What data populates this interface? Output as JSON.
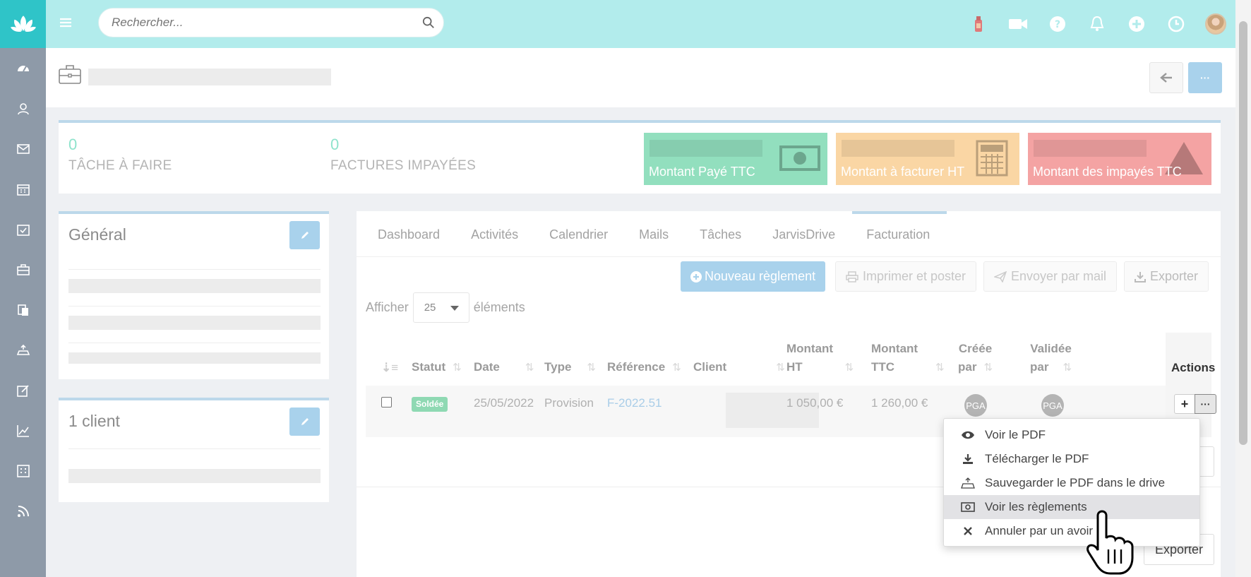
{
  "topbar": {
    "search_placeholder": "Rechercher..."
  },
  "sidebar": {
    "icons": [
      "dashboard-icon",
      "contacts-icon",
      "mail-icon",
      "calendar-icon",
      "tasks-icon",
      "briefcase-icon",
      "documents-icon",
      "drive-icon",
      "edit-icon",
      "chart-icon",
      "grid-icon",
      "rss-icon"
    ]
  },
  "stats": {
    "tasks_count": "0",
    "tasks_label": "TÂCHE À FAIRE",
    "invoices_count": "0",
    "invoices_label": "FACTURES IMPAYÉES",
    "tile_paid": "Montant Payé TTC",
    "tile_to_invoice": "Montant à facturer HT",
    "tile_unpaid": "Montant des impayés TTC",
    "colors": {
      "paid": "#92dfbe",
      "to_invoice": "#fad6a4",
      "unpaid": "#f4a3a3"
    }
  },
  "general_panel": {
    "title": "Général"
  },
  "client_panel": {
    "title": "1 client"
  },
  "tabs": [
    "Dashboard",
    "Activités",
    "Calendrier",
    "Mails",
    "Tâches",
    "JarvisDrive",
    "Facturation"
  ],
  "toolbar": {
    "new_payment": "Nouveau règlement",
    "print": "Imprimer et poster",
    "send_mail": "Envoyer par mail",
    "export": "Exporter"
  },
  "pagination": {
    "show": "Afficher",
    "page_size": "25",
    "items": "éléments"
  },
  "table": {
    "columns": {
      "statut": "Statut",
      "date": "Date",
      "type": "Type",
      "reference": "Référence",
      "client": "Client",
      "montant_ht_1": "Montant",
      "montant_ht_2": "HT",
      "montant_ttc_1": "Montant",
      "montant_ttc_2": "TTC",
      "creee_1": "Créée",
      "creee_2": "par",
      "validee_1": "Validée",
      "validee_2": "par",
      "actions": "Actions"
    },
    "rows": [
      {
        "statut": "Soldée",
        "date": "25/05/2022",
        "type": "Provision",
        "reference": "F-2022.51",
        "montant_ht": "1 050,00 €",
        "montant_ttc": "1 260,00 €",
        "creee_par": "PGA",
        "validee_par": "PGA"
      }
    ]
  },
  "dropdown": {
    "items": [
      {
        "label": "Voir le PDF",
        "icon": "eye-icon"
      },
      {
        "label": "Télécharger le PDF",
        "icon": "download-icon"
      },
      {
        "label": "Sauvegarder le PDF dans le drive",
        "icon": "drive-upload-icon"
      },
      {
        "label": "Voir les règlements",
        "icon": "money-icon"
      },
      {
        "label": "Annuler par un avoir",
        "icon": "close-icon"
      }
    ]
  },
  "footer": {
    "export": "Exporter"
  }
}
